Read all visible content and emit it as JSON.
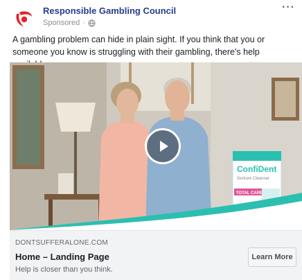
{
  "post": {
    "page_name": "Responsible Gambling Council",
    "sponsored_label": "Sponsored",
    "privacy_icon": "globe-icon",
    "more_icon": "more-options-icon",
    "body_text": "A gambling problem can hide in plain sight. If you think that you or someone you know is struggling with their gambling, there's help available."
  },
  "media": {
    "type": "video",
    "play_icon": "play-icon",
    "product_box_brand": "ConfiDent",
    "product_box_sub": "Denture Cleanser",
    "product_box_tag": "TOTAL CARE"
  },
  "link": {
    "domain": "DONTSUFFERALONE.COM",
    "headline": "Home – Landing Page",
    "description": "Help is closer than you think.",
    "cta_label": "Learn More"
  },
  "colors": {
    "brand_blue": "#283c8c",
    "logo_red": "#e0252b",
    "product_teal": "#2bbfb0",
    "product_pink": "#e0569a"
  }
}
